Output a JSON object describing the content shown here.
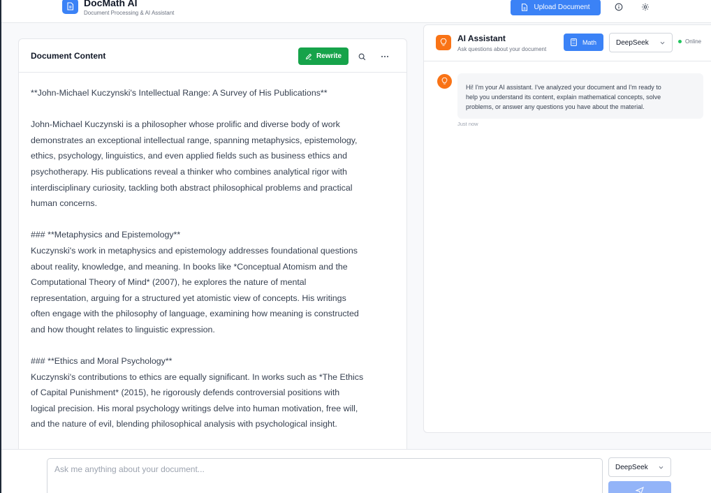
{
  "header": {
    "app_title": "DocMath AI",
    "app_subtitle": "Document Processing & AI Assistant",
    "upload_label": "Upload Document",
    "icons": [
      "document-icon",
      "upload-icon",
      "info-icon",
      "settings-icon"
    ]
  },
  "document": {
    "title": "Document Content",
    "rewrite_label": "Rewrite",
    "paragraphs": [
      [
        "**John-Michael Kuczynski's Intellectual Range: A Survey of His Publications**"
      ],
      [
        "John-Michael Kuczynski is a philosopher whose prolific and diverse body of work",
        "demonstrates an exceptional intellectual range, spanning metaphysics, epistemology,",
        "ethics, psychology, linguistics, and even applied fields such as business ethics and",
        "psychotherapy. His publications reveal a thinker who combines analytical rigor with",
        "interdisciplinary curiosity, tackling both abstract philosophical problems and practical",
        "human concerns."
      ],
      [
        "### **Metaphysics and Epistemology**",
        "Kuczynski's work in metaphysics and epistemology addresses foundational questions",
        "about reality, knowledge, and meaning. In books like *Conceptual Atomism and the",
        "Computational Theory of Mind* (2007), he explores the nature of mental",
        "representation, arguing for a structured yet atomistic view of concepts. His writings",
        "often engage with the philosophy of language, examining how meaning is constructed",
        "and how thought relates to linguistic expression."
      ],
      [
        "### **Ethics and Moral Psychology**",
        "Kuczynski's contributions to ethics are equally significant. In works such as *The Ethics",
        "of Capital Punishment* (2015), he rigorously defends controversial positions with",
        "logical precision. His moral psychology writings delve into human motivation, free will,",
        "and the nature of evil, blending philosophical analysis with psychological insight."
      ]
    ]
  },
  "assistant": {
    "title": "AI Assistant",
    "subtitle": "Ask questions about your document",
    "math_label": "Math",
    "model": "DeepSeek",
    "status": "Online",
    "message_lines": [
      "Hi! I'm your AI assistant. I've analyzed your document and I'm ready to",
      "help you understand its content, explain mathematical concepts, solve",
      "problems, or answer any questions you have about the material."
    ],
    "message_time": "Just now"
  },
  "chat": {
    "placeholder": "Ask me anything about your document...",
    "model": "DeepSeek"
  },
  "colors": {
    "primary": "#3b82f6",
    "rewrite": "#16a34a",
    "assistant_accent": "#f97316",
    "online": "#22c55e"
  }
}
